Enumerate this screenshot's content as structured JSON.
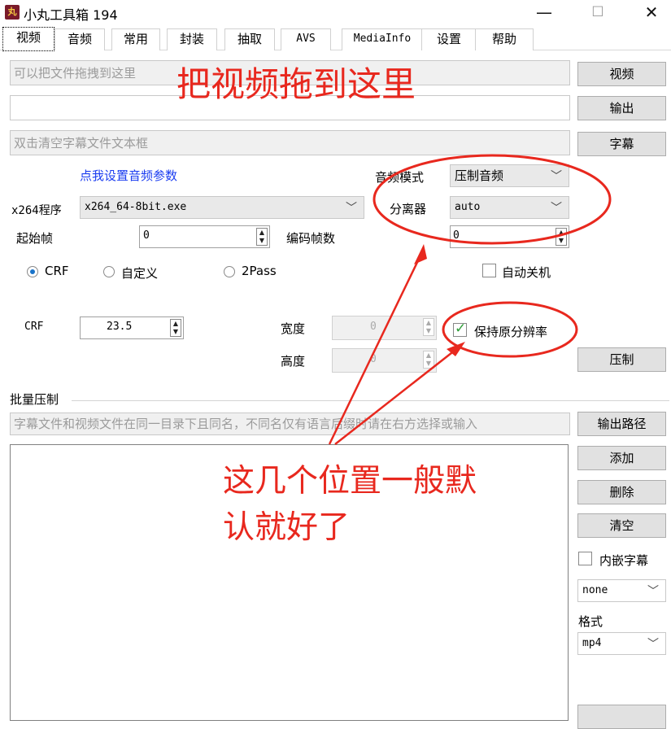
{
  "window": {
    "title": "小丸工具箱 194",
    "icon_glyph": "丸",
    "minimize_glyph": "—",
    "maximize_glyph": "☐",
    "close_glyph": "✕"
  },
  "tabs": [
    {
      "label": "视频",
      "active": true
    },
    {
      "label": "音频"
    },
    {
      "label": "常用"
    },
    {
      "label": "封装"
    },
    {
      "label": "抽取"
    },
    {
      "label": "AVS"
    },
    {
      "label": "MediaInfo"
    },
    {
      "label": "设置"
    },
    {
      "label": "帮助"
    }
  ],
  "video_panel": {
    "video_input_placeholder": "可以把文件拖拽到这里",
    "video_button": "视频",
    "output_button": "输出",
    "subtitle_placeholder": "双击清空字幕文件文本框",
    "subtitle_button": "字幕",
    "audio_settings_link": "点我设置音频参数",
    "audio_mode_label": "音频模式",
    "audio_mode_value": "压制音频",
    "separator_label": "分离器",
    "separator_value": "auto",
    "x264_label": "x264程序",
    "x264_value": "x264_64-8bit.exe",
    "start_frame_label": "起始帧",
    "start_frame_value": "0",
    "encode_frames_label": "编码帧数",
    "encode_frames_value": "0",
    "mode_crf": "CRF",
    "mode_custom": "自定义",
    "mode_2pass": "2Pass",
    "auto_shutdown_label": "自动关机",
    "crf_label": "CRF",
    "crf_value": "23.5",
    "width_label": "宽度",
    "width_value": "0",
    "height_label": "高度",
    "height_value": "0",
    "keep_resolution_label": "保持原分辨率",
    "encode_button": "压制"
  },
  "batch": {
    "group_label": "批量压制",
    "hint_placeholder": "字幕文件和视频文件在同一目录下且同名，不同名仅有语言后缀时请在右方选择或输入",
    "output_path_button": "输出路径",
    "add_button": "添加",
    "delete_button": "删除",
    "clear_button": "清空",
    "embed_subtitle_label": "内嵌字幕",
    "subtitle_lang_value": "none",
    "format_label": "格式",
    "format_value": "mp4"
  },
  "annotations": {
    "drag_here": "把视频拖到这里",
    "default_note_line1": "这几个位置一般默",
    "default_note_line2": "认就好了",
    "annotation_color": "#e8281e"
  },
  "colors": {
    "link_blue": "#1a3cf0",
    "check_green": "#2f9e3a"
  }
}
